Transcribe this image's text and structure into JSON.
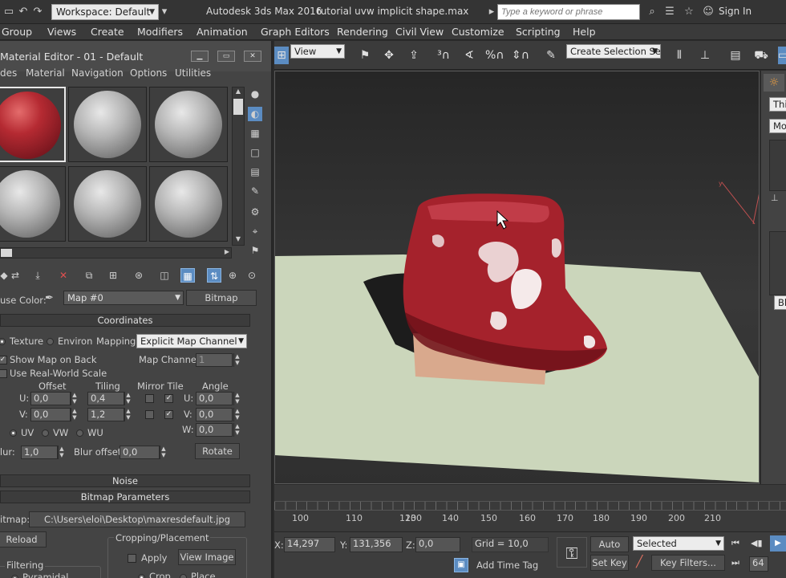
{
  "titlebar": {
    "workspace": "Workspace: Default",
    "app_title": "Autodesk 3ds Max 2016",
    "doc_title": "tutorial uvw implicit shape.max",
    "search_placeholder": "Type a keyword or phrase",
    "sign_in": "Sign In"
  },
  "menubar": {
    "items": [
      "Group",
      "Views",
      "Create",
      "Modifiers",
      "Animation",
      "Graph Editors",
      "Rendering",
      "Civil View",
      "Customize",
      "Scripting",
      "Help"
    ]
  },
  "material_editor": {
    "title": "Material Editor - 01 - Default",
    "menu": [
      "des",
      "Material",
      "Navigation",
      "Options",
      "Utilities"
    ],
    "diffuse_label": "use Color:",
    "map_name": "Map #0",
    "map_type_button": "Bitmap",
    "coordinates": {
      "header": "Coordinates",
      "texture_label": "Texture",
      "environ_label": "Environ",
      "mapping_label": "Mapping:",
      "mapping_value": "Explicit Map Channel",
      "show_map_on_back": "Show Map on Back",
      "map_channel_label": "Map Channel:",
      "map_channel_value": "1",
      "use_real_world_scale": "Use Real-World Scale",
      "offset_header": "Offset",
      "tiling_header": "Tiling",
      "mirror_tile_header": "Mirror Tile",
      "angle_header": "Angle",
      "u_label": "U:",
      "v_label": "V:",
      "w_label": "W:",
      "offset_u": "0,0",
      "offset_v": "0,0",
      "tiling_u": "0,4",
      "tiling_v": "1,2",
      "angle_u": "0,0",
      "angle_v": "0,0",
      "angle_w": "0,0",
      "uv_label": "UV",
      "vw_label": "VW",
      "wu_label": "WU",
      "blur_label": "Blur:",
      "blur_value": "1,0",
      "blur_offset_label": "Blur offset:",
      "blur_offset_value": "0,0",
      "rotate_button": "Rotate"
    },
    "noise_header": "Noise",
    "bitmap_params": {
      "header": "Bitmap Parameters",
      "bitmap_label": "itmap:",
      "bitmap_path": "C:\\Users\\eloi\\Desktop\\maxresdefault.jpg",
      "reload_button": "Reload",
      "cropping_header": "Cropping/Placement",
      "apply_label": "Apply",
      "view_image_button": "View Image",
      "filtering_header": "Filtering",
      "pyramidal_label": "Pyramidal",
      "crop_label": "Crop",
      "place_label": "Place"
    }
  },
  "main_toolbar": {
    "view_dropdown": "View",
    "selection_set": "Create Selection Se"
  },
  "command_panel": {
    "label1": "Thi",
    "label2": "Mod",
    "label3": "Bla"
  },
  "timeline": {
    "ticks": [
      "100",
      "110",
      "120",
      "130",
      "140",
      "150",
      "160",
      "170",
      "180",
      "190",
      "200",
      "210"
    ]
  },
  "statusbar": {
    "x_label": "X:",
    "x_value": "14,297",
    "y_label": "Y:",
    "y_value": "131,356",
    "z_label": "Z:",
    "z_value": "0,0",
    "grid": "Grid = 10,0",
    "add_time_tag": "Add Time Tag",
    "auto_key": "Auto Key",
    "set_key": "Set Key",
    "key_mode": "Selected",
    "key_filters": "Key Filters...",
    "frame": "64"
  },
  "colors": {
    "accent": "#5b8cc2",
    "material_red": "#a5222c",
    "ground_plane": "#cbd6bb"
  }
}
